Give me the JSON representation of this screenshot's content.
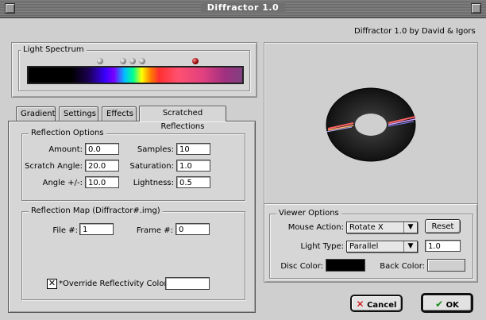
{
  "window": {
    "title": "Diffractor 1.0"
  },
  "header": {
    "credit": "Diffractor 1.0   by David & Igors"
  },
  "light_spectrum": {
    "title": "Light Spectrum"
  },
  "tabs": [
    {
      "label": "Gradient"
    },
    {
      "label": "Settings"
    },
    {
      "label": "Effects"
    },
    {
      "label": "Scratched Reflections"
    }
  ],
  "reflection_options": {
    "title": "Reflection Options",
    "amount_label": "Amount:",
    "amount_value": "0.0",
    "samples_label": "Samples:",
    "samples_value": "10",
    "scratch_angle_label": "Scratch Angle:",
    "scratch_angle_value": "20.0",
    "saturation_label": "Saturation:",
    "saturation_value": "1.0",
    "angle_pm_label": "Angle +/-:",
    "angle_pm_value": "10.0",
    "lightness_label": "Lightness:",
    "lightness_value": "0.5"
  },
  "reflection_map": {
    "title": "Reflection Map (Diffractor#.img)",
    "file_label": "File #:",
    "file_value": "1",
    "frame_label": "Frame #:",
    "frame_value": "0",
    "override_label": "*Override Reflectivity Color:",
    "override_checked": true
  },
  "viewer_options": {
    "title": "Viewer Options",
    "mouse_action_label": "Mouse Action:",
    "mouse_action_value": "Rotate X",
    "reset_label": "Reset",
    "light_type_label": "Light Type:",
    "light_type_value": "Parallel",
    "light_value": "1.0",
    "disc_color_label": "Disc Color:",
    "disc_color": "#000000",
    "back_color_label": "Back Color:",
    "back_color": "#cfcfcf"
  },
  "buttons": {
    "cancel_label": "Cancel",
    "ok_label": "OK"
  },
  "colors": {
    "cancel_x": "#cc0000",
    "ok_check": "#1a8a1a",
    "marker_active": "#8b0000"
  }
}
